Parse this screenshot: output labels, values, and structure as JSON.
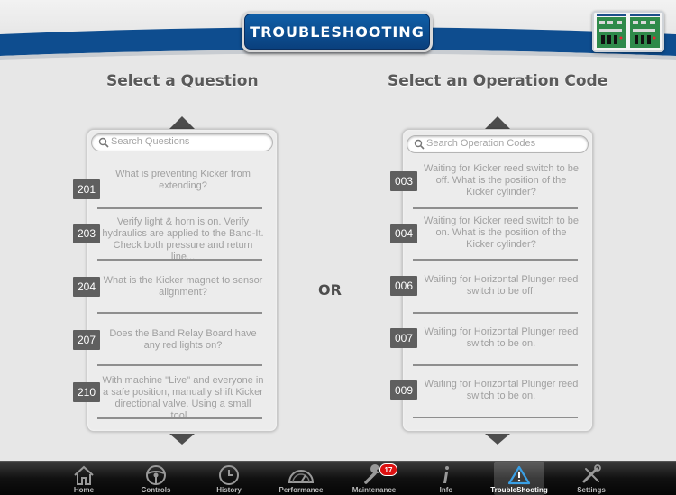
{
  "header": {
    "title": "TROUBLESHOOTING"
  },
  "questions": {
    "heading": "Select a Question",
    "search_placeholder": "Search Questions",
    "items": [
      {
        "code": "201",
        "text": "What is preventing Kicker from extending?"
      },
      {
        "code": "203",
        "text": "Verify light & horn is on.  Verify hydraulics are applied to the Band-It.  Check both pressure and return line..."
      },
      {
        "code": "204",
        "text": "What is the Kicker magnet to sensor alignment?"
      },
      {
        "code": "207",
        "text": "Does the Band Relay Board have any red lights on?"
      },
      {
        "code": "210",
        "text": "With machine \"Live\" and everyone in a safe position, manually shift Kicker directional valve.  Using a small tool..."
      }
    ]
  },
  "or_label": "OR",
  "operations": {
    "heading": "Select an Operation Code",
    "search_placeholder": "Search Operation Codes",
    "items": [
      {
        "code": "003",
        "text": "Waiting for Kicker reed switch to be off.  What is the position of the Kicker cylinder?"
      },
      {
        "code": "004",
        "text": "Waiting for Kicker reed switch to be on.  What is the position of the Kicker cylinder?"
      },
      {
        "code": "006",
        "text": "Waiting for Horizontal Plunger reed switch to be off."
      },
      {
        "code": "007",
        "text": "Waiting for Horizontal Plunger reed switch to be on."
      },
      {
        "code": "009",
        "text": "Waiting for Horizontal Plunger reed switch to be on."
      }
    ]
  },
  "tabs": [
    {
      "label": "Home",
      "icon": "home-icon"
    },
    {
      "label": "Controls",
      "icon": "steering-wheel-icon"
    },
    {
      "label": "History",
      "icon": "clock-icon"
    },
    {
      "label": "Performance",
      "icon": "gauge-icon"
    },
    {
      "label": "Maintenance",
      "icon": "wrench-icon",
      "badge": "17"
    },
    {
      "label": "Info",
      "icon": "info-icon"
    },
    {
      "label": "TroubleShooting",
      "icon": "warning-icon",
      "active": true
    },
    {
      "label": "Settings",
      "icon": "tools-icon"
    }
  ],
  "colors": {
    "header_blue": "#0d4f93",
    "code_tag": "#5f5f5f",
    "badge_red": "#dd1111"
  }
}
